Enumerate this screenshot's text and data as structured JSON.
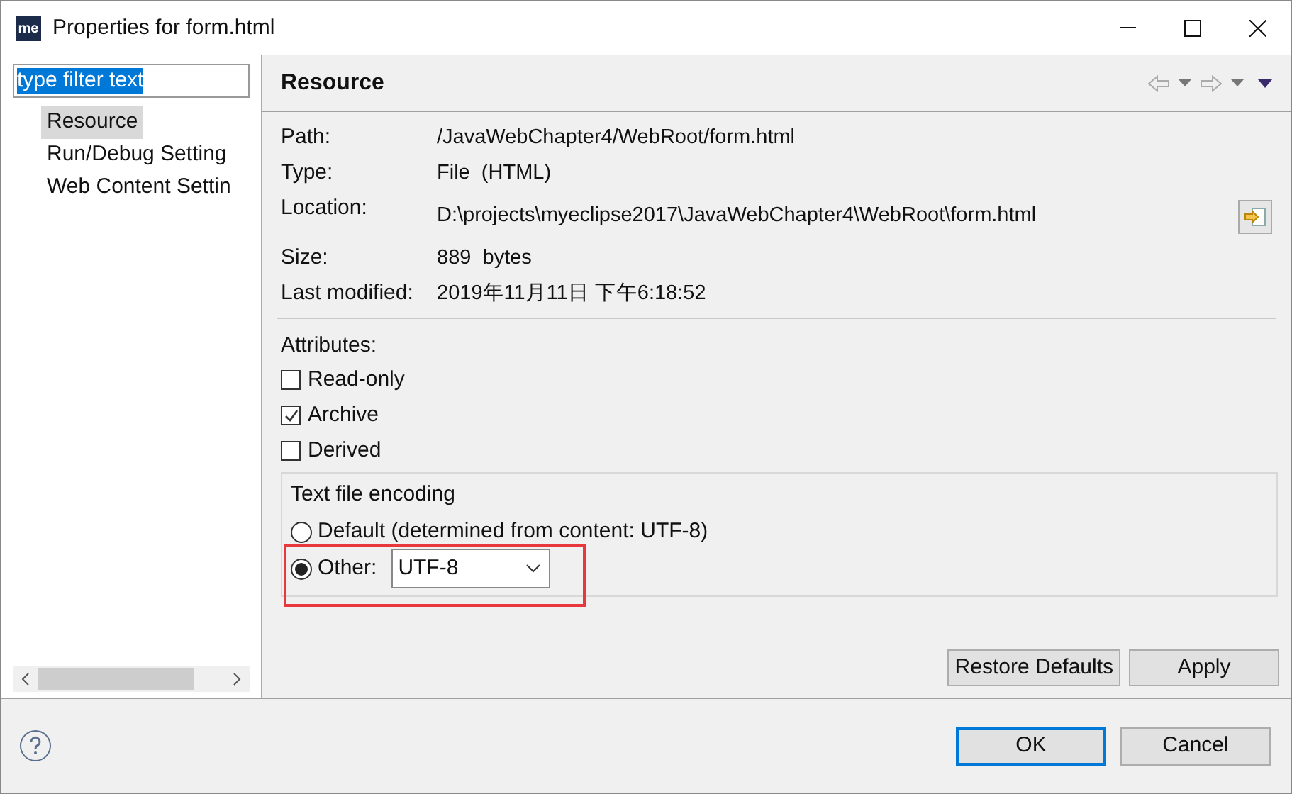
{
  "window": {
    "logo": "me",
    "title": "Properties for form.html"
  },
  "filter": {
    "value": "type filter text"
  },
  "sidebar": {
    "items": [
      {
        "label": "Resource",
        "selected": true
      },
      {
        "label": "Run/Debug Setting",
        "selected": false
      },
      {
        "label": "Web Content Settin",
        "selected": false
      }
    ]
  },
  "page": {
    "title": "Resource",
    "info": [
      {
        "label": "Path:",
        "value": "/JavaWebChapter4/WebRoot/form.html"
      },
      {
        "label": "Type:",
        "value": "File  (HTML)"
      },
      {
        "label": "Location:",
        "value": "D:\\projects\\myeclipse2017\\JavaWebChapter4\\WebRoot\\form.html",
        "kind": "location"
      },
      {
        "label": "Size:",
        "value": "889  bytes"
      },
      {
        "label": "Last modified:",
        "value": "2019年11月11日 下午6:18:52"
      }
    ],
    "attributes_label": "Attributes:",
    "attributes": [
      {
        "label": "Read-only",
        "checked": false
      },
      {
        "label": "Archive",
        "checked": true
      },
      {
        "label": "Derived",
        "checked": false
      }
    ],
    "encoding": {
      "title": "Text file encoding",
      "options": [
        {
          "label": "Default (determined from content: UTF-8)",
          "selected": false
        },
        {
          "label": "Other:",
          "selected": true
        }
      ],
      "other_value": "UTF-8"
    },
    "buttons": [
      "Restore Defaults",
      "Apply"
    ]
  },
  "footer": {
    "buttons": [
      {
        "label": "OK",
        "default": true
      },
      {
        "label": "Cancel",
        "default": false
      }
    ]
  }
}
